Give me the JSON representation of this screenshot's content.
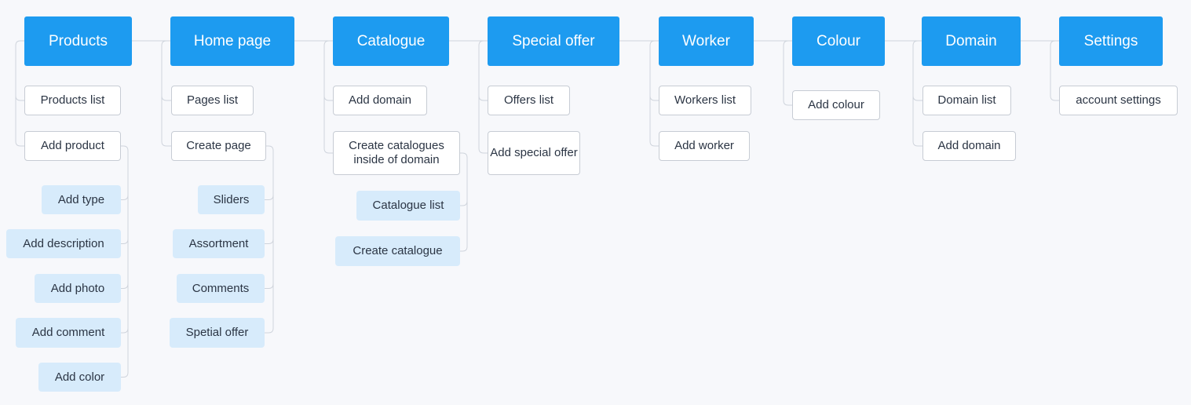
{
  "sections": [
    {
      "title": "Products",
      "items": [
        {
          "label": "Products list",
          "children": []
        },
        {
          "label": "Add product",
          "children": [
            "Add type",
            "Add description",
            "Add photo",
            "Add comment",
            "Add color"
          ]
        }
      ]
    },
    {
      "title": "Home page",
      "items": [
        {
          "label": "Pages list",
          "children": []
        },
        {
          "label": "Create page",
          "children": [
            "Sliders",
            "Assortment",
            "Comments",
            "Spetial offer"
          ]
        }
      ]
    },
    {
      "title": "Catalogue",
      "items": [
        {
          "label": "Add domain",
          "children": []
        },
        {
          "label": "Create catalogues inside of domain",
          "children": [
            "Catalogue list",
            "Create catalogue"
          ]
        }
      ]
    },
    {
      "title": "Special offer",
      "items": [
        {
          "label": "Offers list",
          "children": []
        },
        {
          "label": "Add special offer",
          "children": []
        }
      ]
    },
    {
      "title": "Worker",
      "items": [
        {
          "label": "Workers list",
          "children": []
        },
        {
          "label": "Add worker",
          "children": []
        }
      ]
    },
    {
      "title": "Colour",
      "items": [
        {
          "label": "Add colour",
          "children": []
        }
      ]
    },
    {
      "title": "Domain",
      "items": [
        {
          "label": "Domain list",
          "children": []
        },
        {
          "label": "Add domain",
          "children": []
        }
      ]
    },
    {
      "title": "Settings",
      "items": [
        {
          "label": "account settings",
          "children": []
        }
      ]
    }
  ],
  "colors": {
    "section_fill": "#1d9bf0",
    "item_fill": "#ffffff",
    "subitem_fill": "#d7ebfb",
    "connector": "#cfd4dc",
    "background": "#f7f8fb"
  }
}
